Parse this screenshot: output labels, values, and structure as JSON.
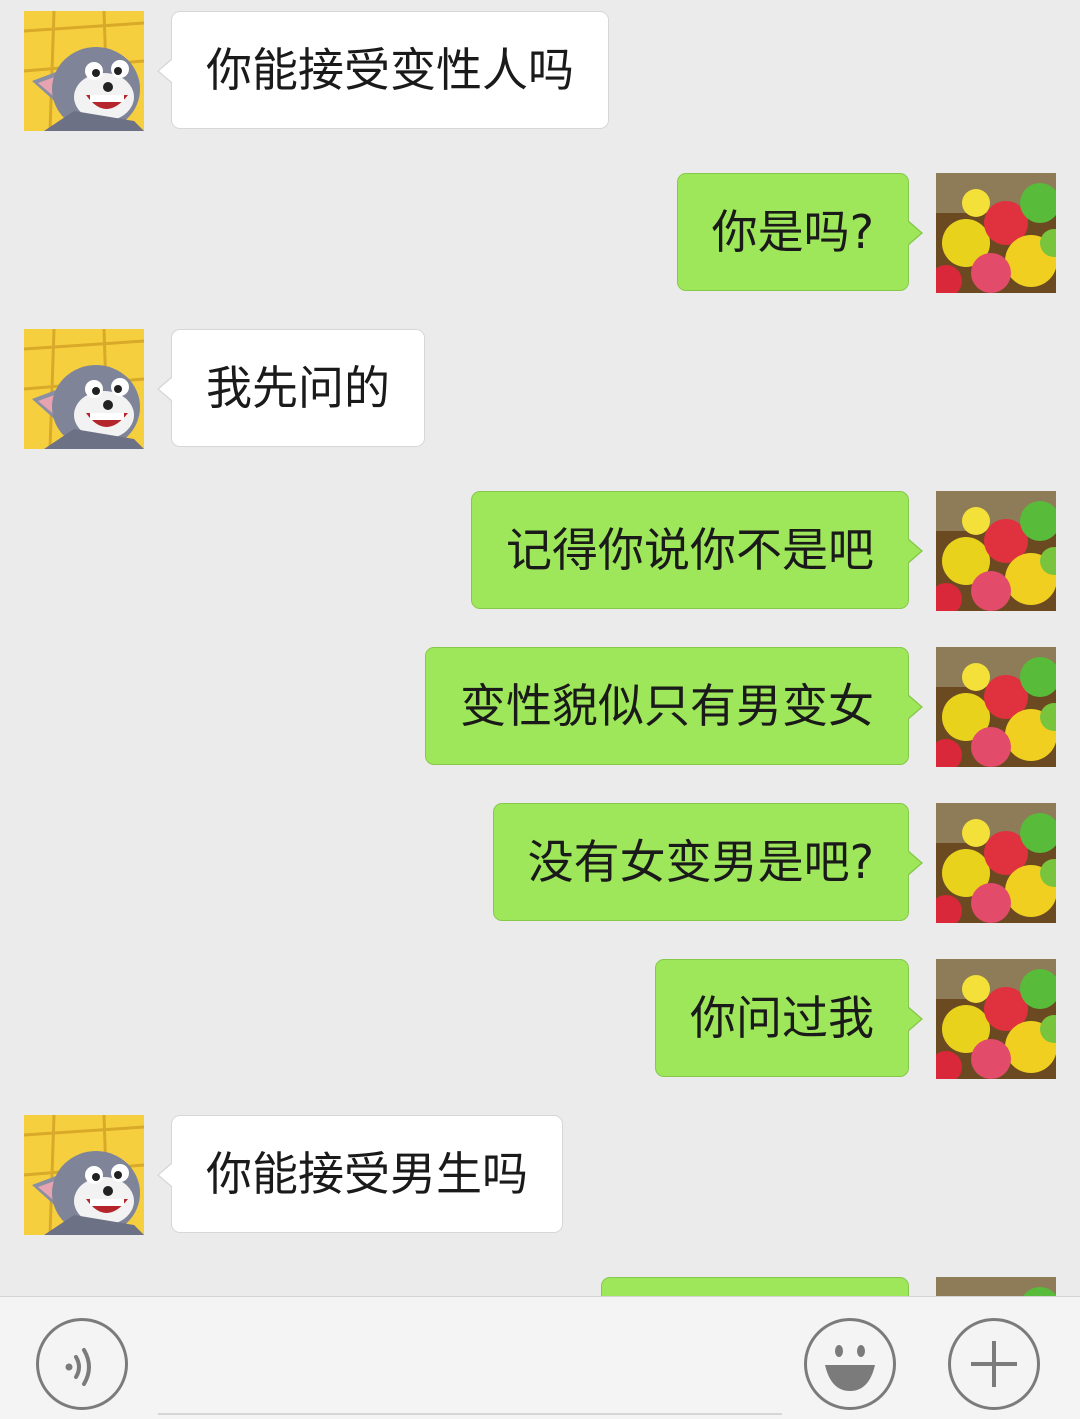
{
  "colors": {
    "background": "#ebebeb",
    "incoming_bubble": "#ffffff",
    "outgoing_bubble": "#9fe75a",
    "icon_stroke": "#7b7b7b"
  },
  "avatars": {
    "contact": "cartoon-cat-avatar",
    "self": "gummy-candy-avatar"
  },
  "messages": [
    {
      "side": "incoming",
      "text": "你能接受变性人吗"
    },
    {
      "side": "outgoing",
      "text": "你是吗?"
    },
    {
      "side": "incoming",
      "text": "我先问的"
    },
    {
      "side": "outgoing",
      "text": "记得你说你不是吧"
    },
    {
      "side": "outgoing",
      "text": "变性貌似只有男变女"
    },
    {
      "side": "outgoing",
      "text": "没有女变男是吧?"
    },
    {
      "side": "outgoing",
      "text": "你问过我"
    },
    {
      "side": "incoming",
      "text": "你能接受男生吗"
    }
  ],
  "input_bar": {
    "voice_icon": "voice-icon",
    "emoji_icon": "emoji-icon",
    "plus_icon": "plus-icon",
    "message_value": ""
  }
}
